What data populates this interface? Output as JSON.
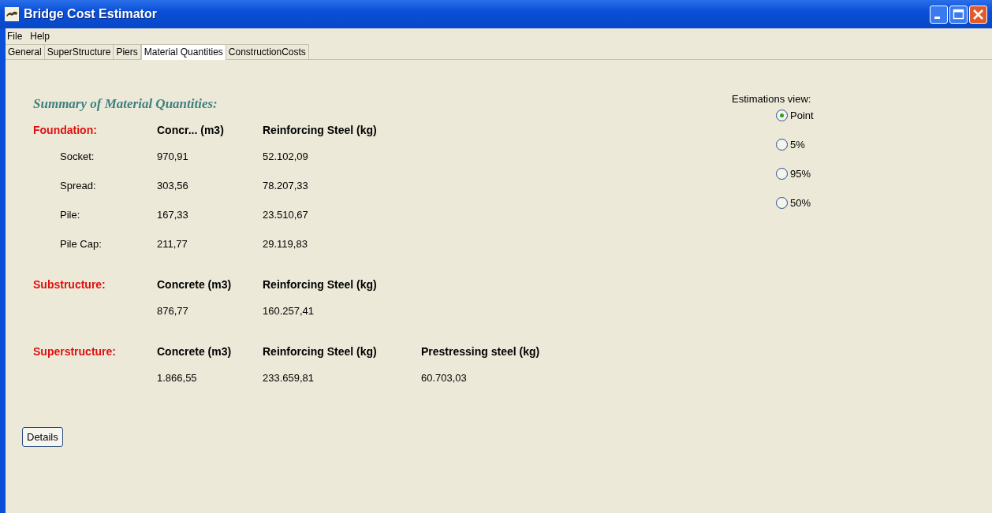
{
  "window": {
    "title": "Bridge Cost Estimator"
  },
  "menu": [
    "File",
    "Help"
  ],
  "tabs": [
    {
      "label": "General",
      "selected": false
    },
    {
      "label": "SuperStructure",
      "selected": false
    },
    {
      "label": "Piers",
      "selected": false
    },
    {
      "label": "Material Quantities",
      "selected": true
    },
    {
      "label": "ConstructionCosts",
      "selected": false
    }
  ],
  "summary_title": "Summary of Material Quantities:",
  "sections": [
    {
      "name": "Foundation:",
      "columns": [
        "Concr... (m3)",
        "Reinforcing Steel (kg)"
      ],
      "rows": [
        {
          "label": "Socket:",
          "values": [
            "970,91",
            "52.102,09"
          ]
        },
        {
          "label": "Spread:",
          "values": [
            "303,56",
            "78.207,33"
          ]
        },
        {
          "label": "Pile:",
          "values": [
            "167,33",
            "23.510,67"
          ]
        },
        {
          "label": "Pile Cap:",
          "values": [
            "211,77",
            "29.119,83"
          ]
        }
      ]
    },
    {
      "name": "Substructure:",
      "columns": [
        "Concrete (m3)",
        "Reinforcing Steel (kg)"
      ],
      "rows": [
        {
          "values": [
            "876,77",
            "160.257,41"
          ]
        }
      ]
    },
    {
      "name": "Superstructure:",
      "columns": [
        "Concrete (m3)",
        "Reinforcing Steel (kg)",
        "Prestressing steel (kg)"
      ],
      "rows": [
        {
          "values": [
            "1.866,55",
            "233.659,81",
            "60.703,03"
          ]
        }
      ]
    }
  ],
  "details_button": "Details",
  "estimations": {
    "label": "Estimations view:",
    "options": [
      {
        "label": "Point",
        "selected": true
      },
      {
        "label": "5%",
        "selected": false
      },
      {
        "label": "95%",
        "selected": false
      },
      {
        "label": "50%",
        "selected": false
      }
    ]
  }
}
